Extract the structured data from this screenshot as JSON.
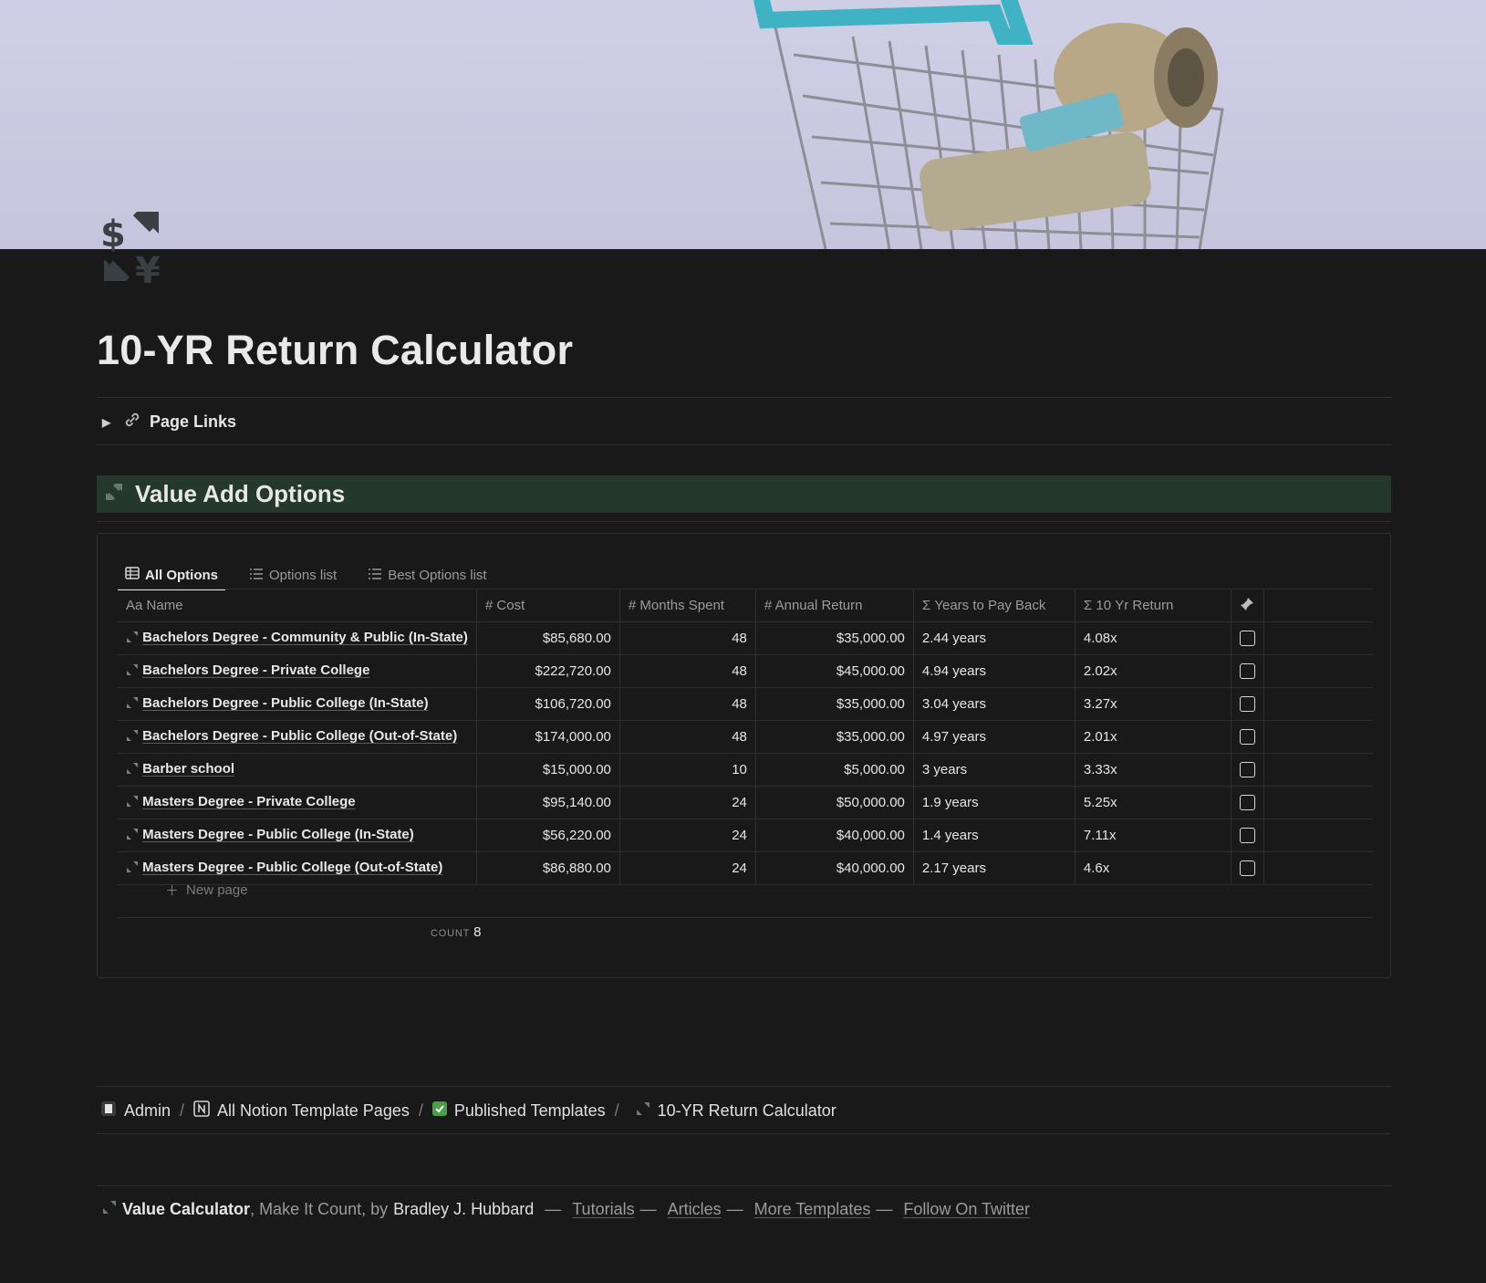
{
  "page": {
    "title": "10-YR Return Calculator",
    "toggle_label": "Page Links",
    "callout_heading": "Value Add Options"
  },
  "database": {
    "views": [
      {
        "label": "All Options",
        "active": true,
        "icon": "table-icon"
      },
      {
        "label": "Options list",
        "active": false,
        "icon": "list-icon"
      },
      {
        "label": "Best Options list",
        "active": false,
        "icon": "list-icon"
      }
    ],
    "columns": {
      "name": {
        "prefix": "Aa",
        "label": "Name"
      },
      "cost": {
        "prefix": "#",
        "label": "Cost"
      },
      "months": {
        "prefix": "#",
        "label": "Months Spent"
      },
      "annual": {
        "prefix": "#",
        "label": "Annual Return"
      },
      "payback": {
        "prefix": "Σ",
        "label": "Years to Pay Back"
      },
      "ten_yr": {
        "prefix": "Σ",
        "label": "10 Yr Return"
      }
    },
    "rows": [
      {
        "name": "Bachelors Degree - Community & Public (In-State)",
        "cost": "$85,680.00",
        "months": "48",
        "annual": "$35,000.00",
        "payback": "2.44 years",
        "ten_yr": "4.08x",
        "checked": false
      },
      {
        "name": "Bachelors Degree - Private College",
        "cost": "$222,720.00",
        "months": "48",
        "annual": "$45,000.00",
        "payback": "4.94 years",
        "ten_yr": "2.02x",
        "checked": false
      },
      {
        "name": "Bachelors Degree - Public College (In-State)",
        "cost": "$106,720.00",
        "months": "48",
        "annual": "$35,000.00",
        "payback": "3.04 years",
        "ten_yr": "3.27x",
        "checked": false
      },
      {
        "name": "Bachelors Degree - Public College (Out-of-State)",
        "cost": "$174,000.00",
        "months": "48",
        "annual": "$35,000.00",
        "payback": "4.97 years",
        "ten_yr": "2.01x",
        "checked": false
      },
      {
        "name": "Barber school",
        "cost": "$15,000.00",
        "months": "10",
        "annual": "$5,000.00",
        "payback": "3 years",
        "ten_yr": "3.33x",
        "checked": false
      },
      {
        "name": "Masters Degree - Private College",
        "cost": "$95,140.00",
        "months": "24",
        "annual": "$50,000.00",
        "payback": "1.9 years",
        "ten_yr": "5.25x",
        "checked": false
      },
      {
        "name": "Masters Degree - Public College (In-State)",
        "cost": "$56,220.00",
        "months": "24",
        "annual": "$40,000.00",
        "payback": "1.4 years",
        "ten_yr": "7.11x",
        "checked": false
      },
      {
        "name": "Masters Degree - Public College (Out-of-State)",
        "cost": "$86,880.00",
        "months": "24",
        "annual": "$40,000.00",
        "payback": "2.17 years",
        "ten_yr": "4.6x",
        "checked": false
      }
    ],
    "new_page_label": "New page",
    "count_label": "COUNT",
    "count_value": "8"
  },
  "breadcrumbs": [
    {
      "label": "Admin",
      "icon": "document-icon"
    },
    {
      "label": "All Notion Template Pages",
      "icon": "notion-icon"
    },
    {
      "label": "Published Templates",
      "icon": "checkmark-icon"
    },
    {
      "label": "10-YR Return Calculator",
      "icon": "exchange-icon"
    }
  ],
  "breadcrumb_sep": "/",
  "footer": {
    "app_name": "Value Calculator",
    "tagline": ", Make It Count, by",
    "author": "Bradley J. Hubbard",
    "links": [
      "Tutorials",
      "Articles",
      "More Templates",
      "Follow On Twitter"
    ],
    "dash": "—"
  },
  "colors": {
    "background": "#191919",
    "callout_bg": "#24392c",
    "cover_bg": "#cfcfe6",
    "accent_teal": "#4fb6c9"
  }
}
